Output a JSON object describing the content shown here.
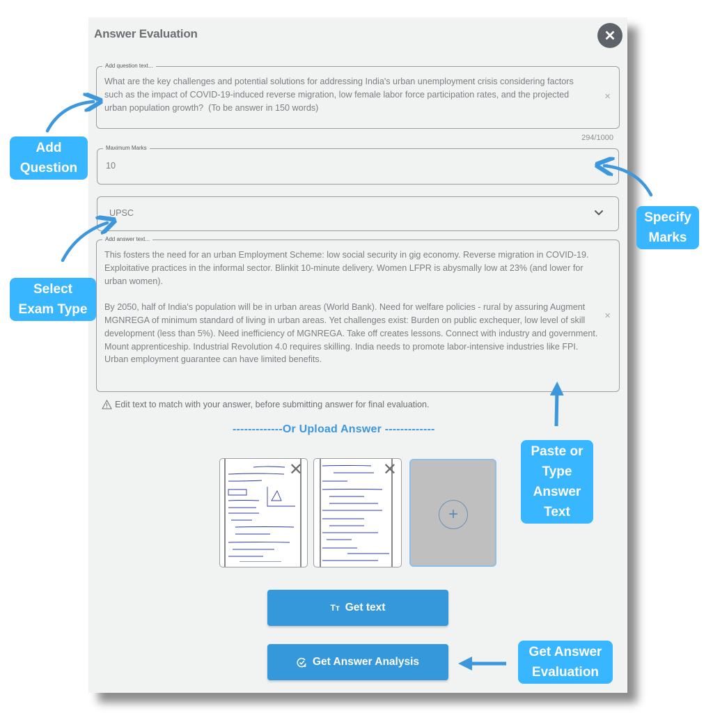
{
  "dialog": {
    "title": "Answer Evaluation",
    "close_icon": "close-icon"
  },
  "question": {
    "label": "Add question text...",
    "value": "What are the key challenges and potential solutions for addressing India's urban unemployment crisis considering factors such as the impact of COVID-19-induced reverse migration, low female labor force participation rates, and the projected urban population growth?  (To be answer in 150 words)",
    "counter": "294/1000",
    "clear_icon": "×"
  },
  "marks": {
    "label": "Maximum Marks",
    "value": "10",
    "clear_icon": "×"
  },
  "exam_type": {
    "selected": "UPSC"
  },
  "answer": {
    "label": "Add answer text...",
    "value": "This fosters the need for an urban Employment Scheme: low social security in gig economy. Reverse migration in COVID-19. Exploitative practices in the informal sector. Blinkit 10-minute delivery. Women LFPR is abysmally low at 23% (and lower for urban women).\n\nBy 2050, half of India's population will be in urban areas (World Bank). Need for welfare policies - rural by assuring Augment MGNREGA of minimum standard of living in urban areas. Yet challenges exist: Burden on public exchequer, low level of skill development (less than 5%). Need inefficiency of MGNREGA. Take off creates lessons. Connect with industry and government. Mount apprenticeship. Industrial Revolution 4.0 requires skilling. India needs to promote labor-intensive industries like FPI. Urban employment guarantee can have limited benefits.",
    "clear_icon": "×"
  },
  "warning": {
    "icon": "warning-icon",
    "text": "Edit text to match with your answer, before submitting answer for final evaluation."
  },
  "upload": {
    "divider_text": "-------------Or Upload Answer -------------",
    "remove_icon": "✕",
    "add_icon": "+",
    "images": [
      {
        "name": "handwritten-answer-page-1"
      },
      {
        "name": "handwritten-answer-page-2"
      }
    ]
  },
  "buttons": {
    "get_text": {
      "icon": "Tт",
      "label": "Get text"
    },
    "get_analysis": {
      "label": "Get Answer Analysis"
    }
  },
  "annotations": {
    "add_question": "Add\nQuestion",
    "select_exam": "Select\nExam Type",
    "specify_marks": "Specify\nMarks",
    "paste_answer": "Paste or\nType\nAnswer\nText",
    "get_evaluation": "Get Answer\nEvaluation"
  },
  "colors": {
    "accent": "#3498db",
    "callout": "#38b6ff",
    "arrow": "#3d97dd",
    "panel_bg": "#f1f2f2"
  }
}
